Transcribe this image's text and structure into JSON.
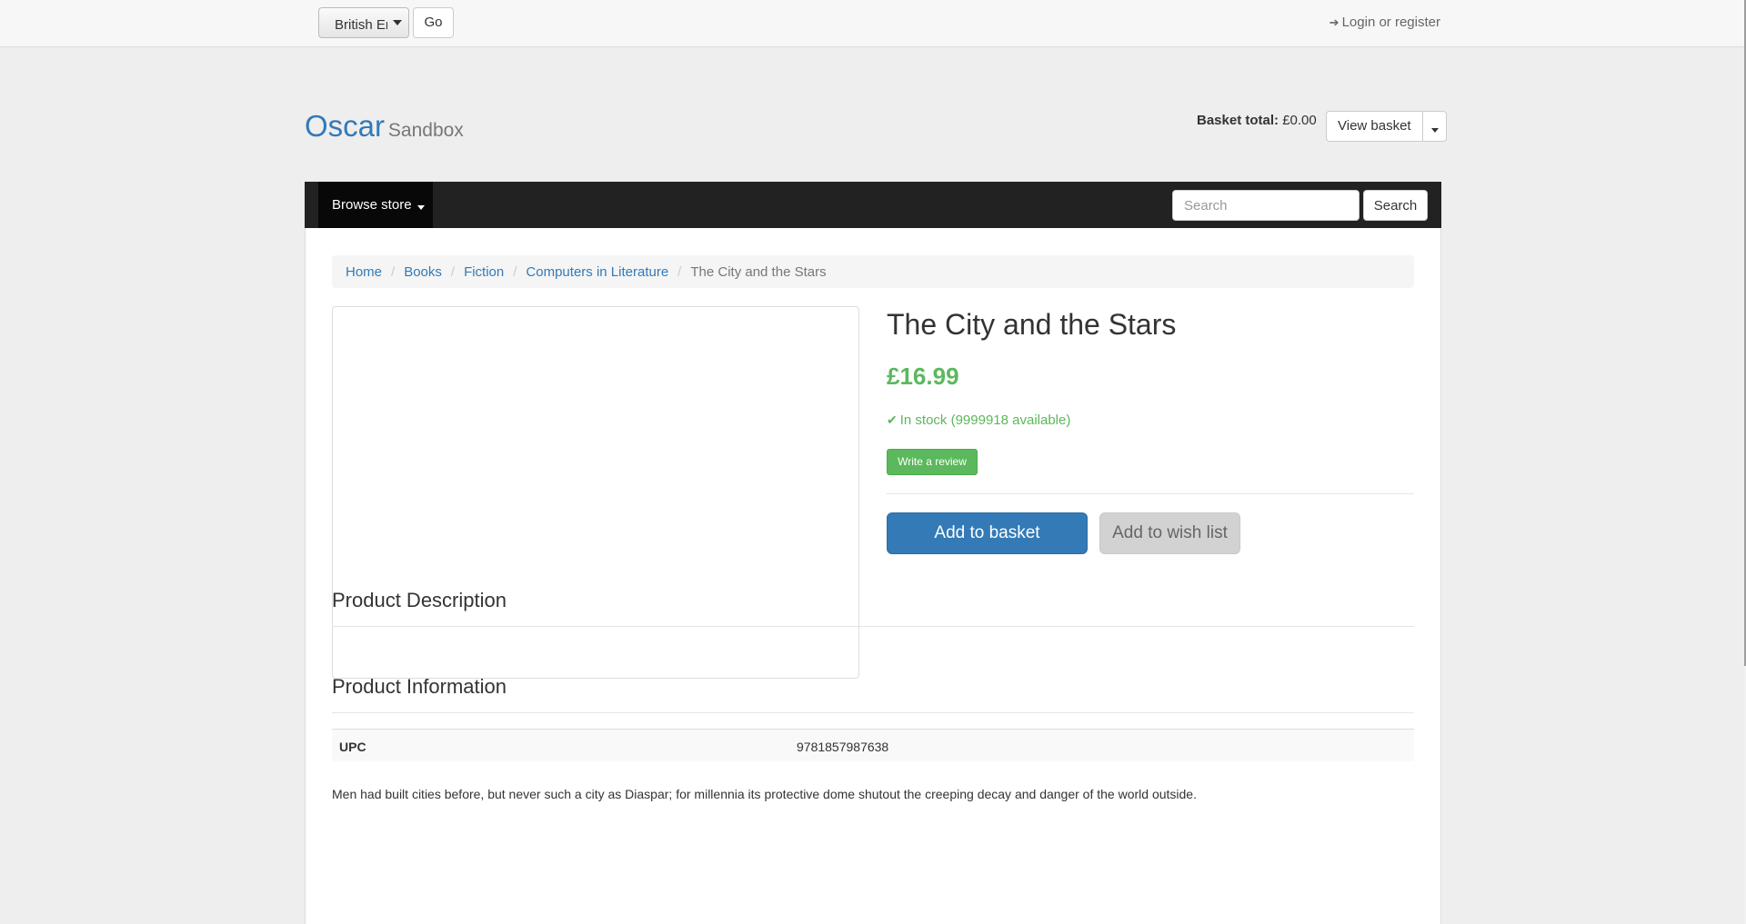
{
  "topbar": {
    "language_selected": "British English",
    "go_label": "Go",
    "login_label": "Login or register"
  },
  "header": {
    "brand_main": "Oscar",
    "brand_sub": "Sandbox",
    "basket_total_label": "Basket total:",
    "basket_total_value": "£0.00",
    "view_basket_label": "View basket"
  },
  "navbar": {
    "browse_label": "Browse store",
    "search_placeholder": "Search",
    "search_button": "Search"
  },
  "breadcrumb": [
    {
      "label": "Home"
    },
    {
      "label": "Books"
    },
    {
      "label": "Fiction"
    },
    {
      "label": "Computers in Literature"
    },
    {
      "label": "The City and the Stars"
    }
  ],
  "product": {
    "title": "The City and the Stars",
    "price": "£16.99",
    "stock": "In stock (9999918 available)",
    "write_review_label": "Write a review",
    "add_to_basket_label": "Add to basket",
    "add_to_wishlist_label": "Add to wish list"
  },
  "description": {
    "heading": "Product Description",
    "text": "Men had built cities before, but never such a city as Diaspar; for millennia its protective dome shutout the creeping decay and danger of the world outside."
  },
  "information": {
    "heading": "Product Information",
    "rows": [
      {
        "label": "UPC",
        "value": "9781857987638"
      }
    ]
  },
  "icons": {
    "login": "sign-in-icon",
    "stock": "check-icon"
  },
  "colors": {
    "link": "#337ab7",
    "success": "#5cb85c",
    "navbar": "#222222",
    "primary": "#337ab7"
  }
}
